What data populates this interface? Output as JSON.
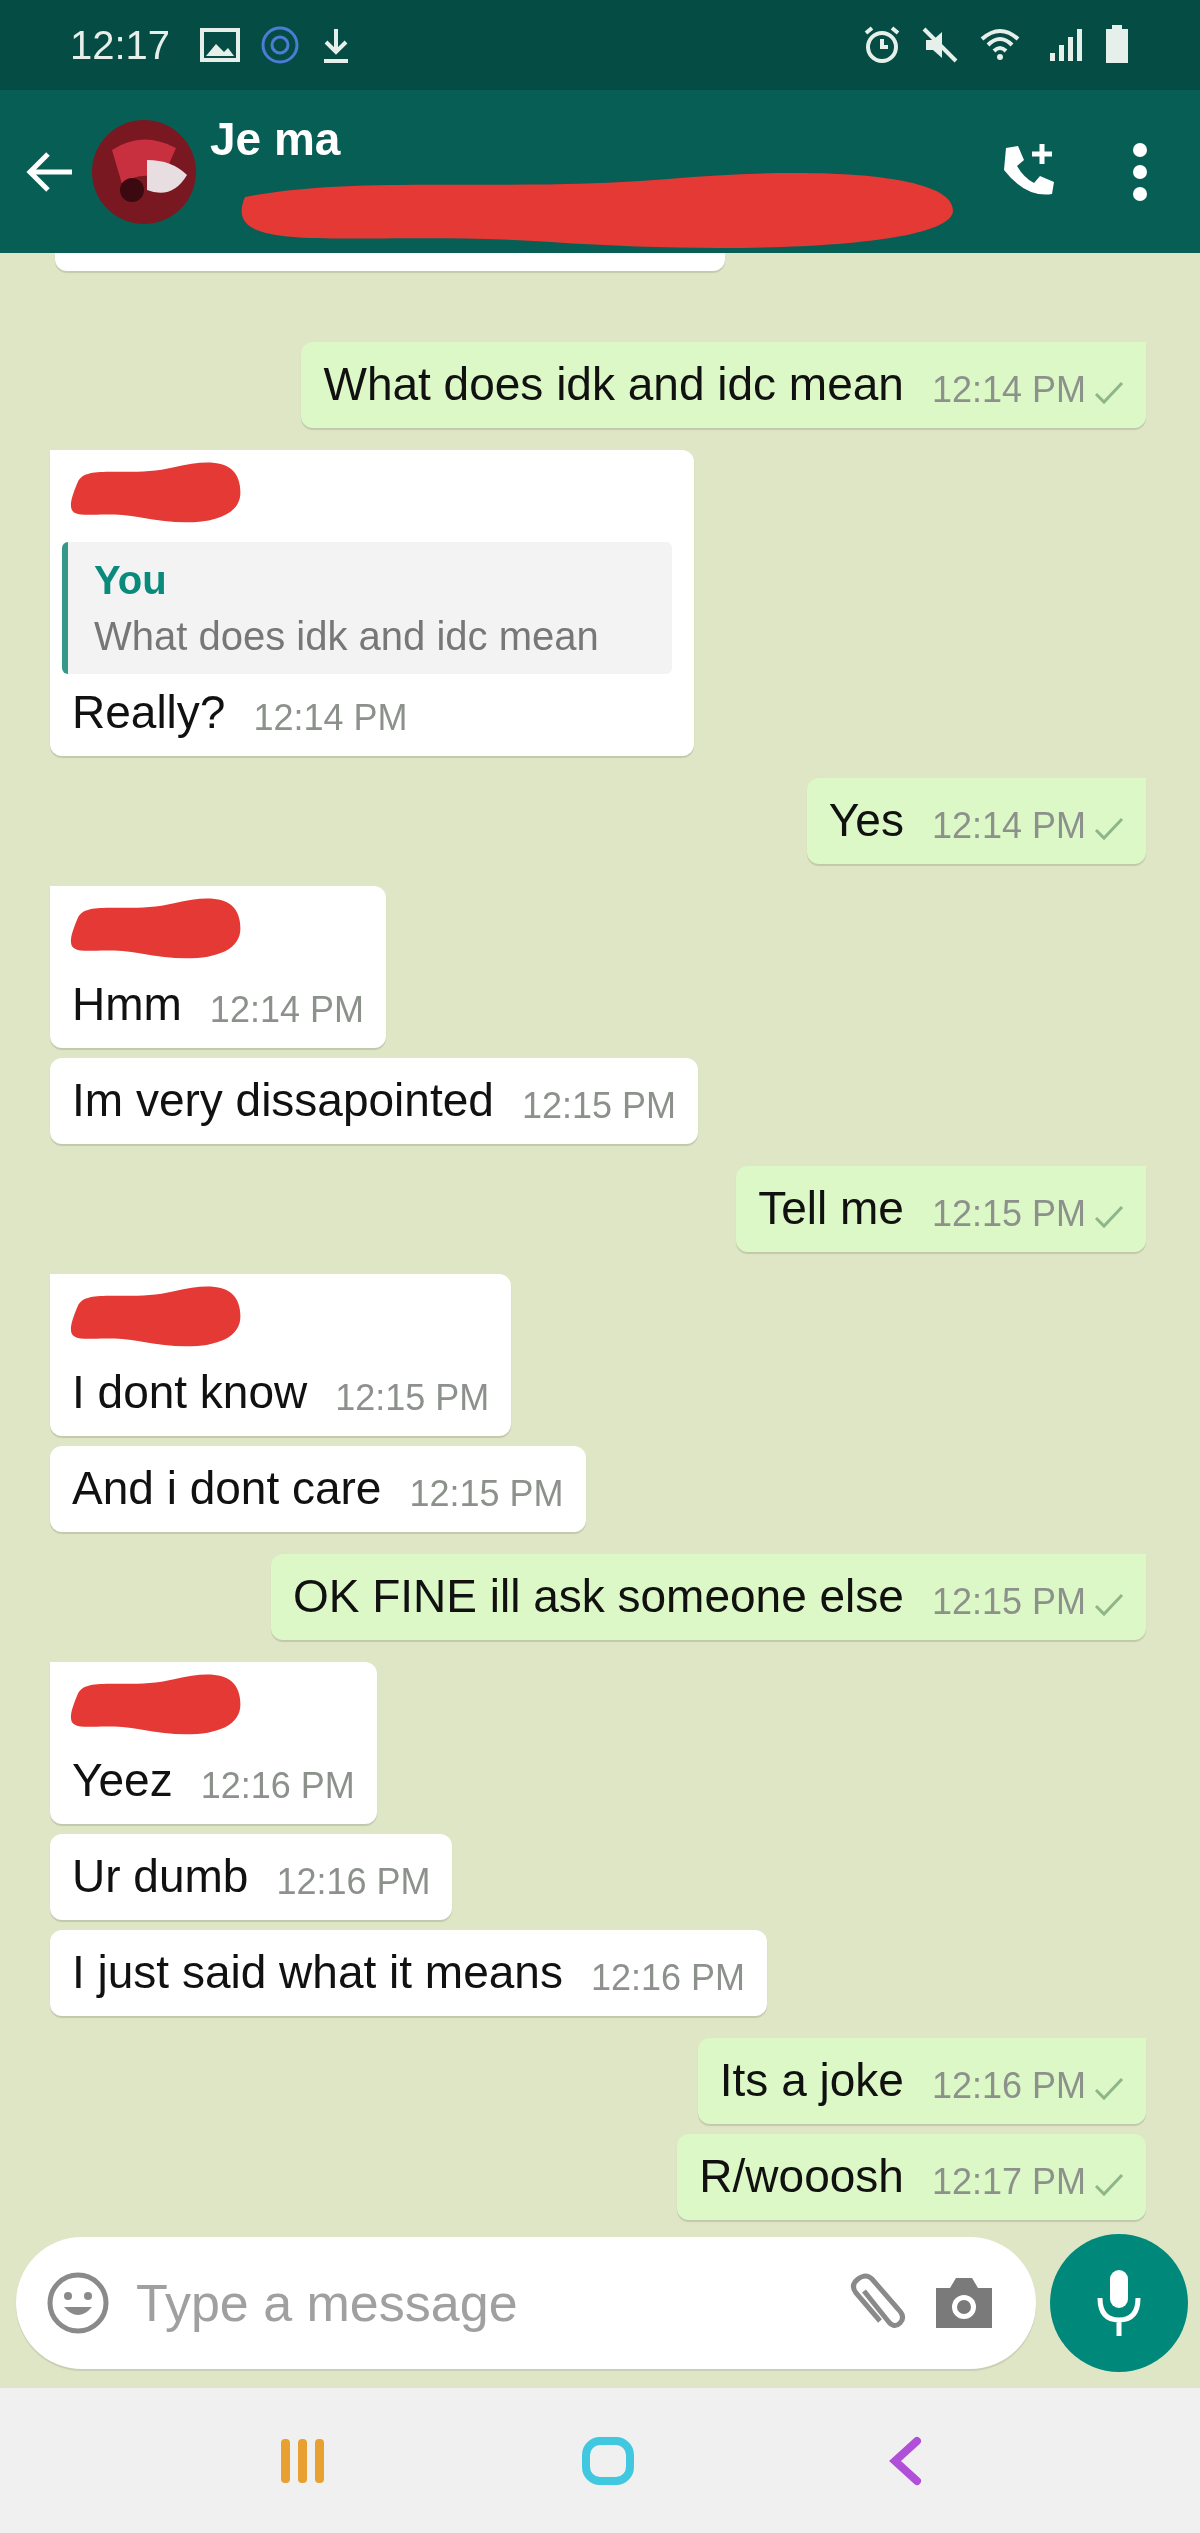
{
  "status_bar": {
    "time": "12:17"
  },
  "header": {
    "contact_name": "Je ma",
    "subtitle_redacted": true
  },
  "messages": [
    {
      "kind": "incoming-cut"
    },
    {
      "kind": "outgoing",
      "text": "What does idk and idc mean",
      "time": "12:14 PM",
      "group_start": true
    },
    {
      "kind": "incoming",
      "sender_redacted": true,
      "quote": {
        "author": "You",
        "text": "What does idk and idc mean"
      },
      "text": "Really?",
      "time": "12:14 PM",
      "group_start": true
    },
    {
      "kind": "outgoing",
      "text": "Yes",
      "time": "12:14 PM",
      "group_start": true
    },
    {
      "kind": "incoming",
      "sender_redacted": true,
      "text": "Hmm",
      "time": "12:14 PM",
      "group_start": true
    },
    {
      "kind": "incoming",
      "sender_redacted": false,
      "text": "Im very dissapointed",
      "time": "12:15 PM",
      "group_start": false
    },
    {
      "kind": "outgoing",
      "text": "Tell me",
      "time": "12:15 PM",
      "group_start": true
    },
    {
      "kind": "incoming",
      "sender_redacted": true,
      "text": "I dont know",
      "time": "12:15 PM",
      "group_start": true
    },
    {
      "kind": "incoming",
      "sender_redacted": false,
      "text": "And i dont care",
      "time": "12:15 PM",
      "group_start": false
    },
    {
      "kind": "outgoing",
      "text": "OK FINE ill ask someone else",
      "time": "12:15 PM",
      "group_start": true
    },
    {
      "kind": "incoming",
      "sender_redacted": true,
      "text": "Yeez",
      "time": "12:16 PM",
      "group_start": true
    },
    {
      "kind": "incoming",
      "sender_redacted": false,
      "text": "Ur dumb",
      "time": "12:16 PM",
      "group_start": false
    },
    {
      "kind": "incoming",
      "sender_redacted": false,
      "text": "I just said what it means",
      "time": "12:16 PM",
      "group_start": false
    },
    {
      "kind": "outgoing",
      "text": "Its a joke",
      "time": "12:16 PM",
      "group_start": true
    },
    {
      "kind": "outgoing",
      "text": "R/wooosh",
      "time": "12:17 PM",
      "group_start": false
    }
  ],
  "composer": {
    "placeholder": "Type a message"
  }
}
